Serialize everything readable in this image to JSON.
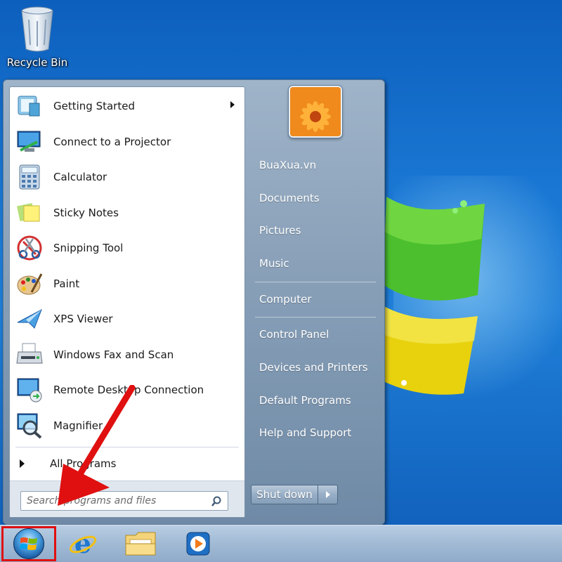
{
  "desktop": {
    "icons": [
      {
        "label": "Recycle Bin",
        "icon": "recycle-bin-icon"
      }
    ]
  },
  "start_menu": {
    "programs": [
      {
        "label": "Getting Started",
        "icon": "getting-started-icon",
        "has_submenu": true
      },
      {
        "label": "Connect to a Projector",
        "icon": "projector-icon",
        "has_submenu": false
      },
      {
        "label": "Calculator",
        "icon": "calculator-icon",
        "has_submenu": false
      },
      {
        "label": "Sticky Notes",
        "icon": "sticky-notes-icon",
        "has_submenu": false
      },
      {
        "label": "Snipping Tool",
        "icon": "snipping-tool-icon",
        "has_submenu": false
      },
      {
        "label": "Paint",
        "icon": "paint-palette-icon",
        "has_submenu": false
      },
      {
        "label": "XPS Viewer",
        "icon": "xps-viewer-icon",
        "has_submenu": false
      },
      {
        "label": "Windows Fax and Scan",
        "icon": "fax-scanner-icon",
        "has_submenu": false
      },
      {
        "label": "Remote Desktop Connection",
        "icon": "remote-desktop-icon",
        "has_submenu": false
      },
      {
        "label": "Magnifier",
        "icon": "magnifier-icon",
        "has_submenu": false
      }
    ],
    "all_programs_label": "All Programs",
    "search": {
      "placeholder": "Search programs and files"
    },
    "right_items": [
      {
        "label": "BuaXua.vn"
      },
      {
        "label": "Documents"
      },
      {
        "label": "Pictures"
      },
      {
        "label": "Music"
      },
      {
        "label": "Computer"
      },
      {
        "label": "Control Panel"
      },
      {
        "label": "Devices and Printers"
      },
      {
        "label": "Default Programs"
      },
      {
        "label": "Help and Support"
      }
    ],
    "shutdown_label": "Shut down"
  },
  "taskbar": {
    "start_button": "windows-start-orb-icon",
    "pinned_apps": [
      "internet-explorer-icon",
      "windows-explorer-icon",
      "windows-media-player-icon"
    ],
    "start_highlight_color": "#e01010"
  },
  "annotation": {
    "arrow_color": "#e01010"
  }
}
